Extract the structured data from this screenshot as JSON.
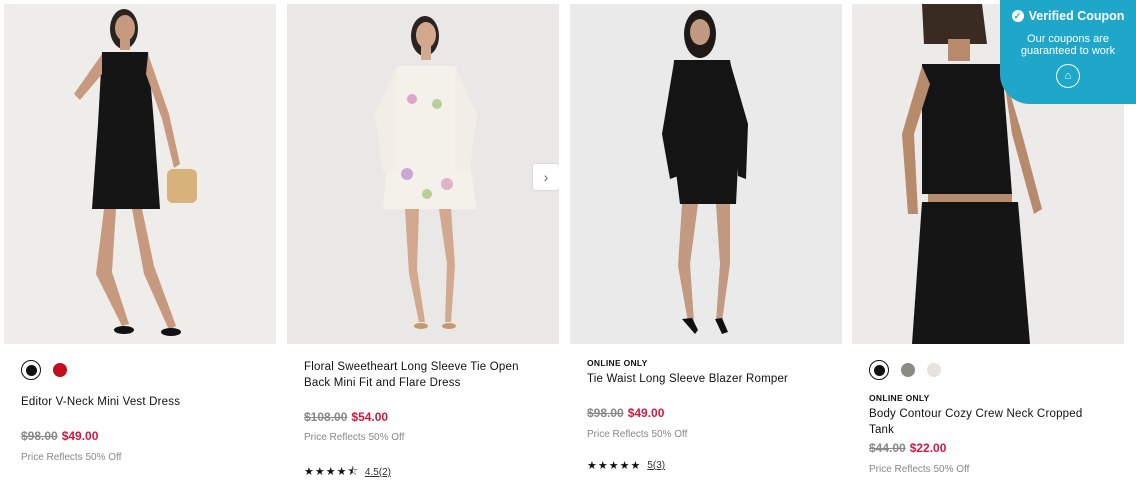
{
  "products": [
    {
      "name": "Editor V-Neck Mini Vest Dress",
      "tag": "",
      "swatches": [
        "#111111",
        "#c40e1e"
      ],
      "original_price": "$98.00",
      "sale_price": "$49.00",
      "note": "Price Reflects 50% Off",
      "rating": "",
      "rating_count": ""
    },
    {
      "name": "Floral Sweetheart Long Sleeve Tie Open Back Mini Fit and Flare Dress",
      "tag": "",
      "swatches": [],
      "original_price": "$108.00",
      "sale_price": "$54.00",
      "note": "Price Reflects 50% Off",
      "rating_stars": "★★★★⯪",
      "rating_count": "4.5(2)"
    },
    {
      "name": "Tie Waist Long Sleeve Blazer Romper",
      "tag": "ONLINE ONLY",
      "swatches": [],
      "original_price": "$98.00",
      "sale_price": "$49.00",
      "note": "Price Reflects 50% Off",
      "rating_stars": "★★★★★",
      "rating_count": "5(3)"
    },
    {
      "name": "Body Contour Cozy Crew Neck Cropped Tank",
      "tag": "ONLINE ONLY",
      "swatches": [
        "#111111",
        "#8a8a86",
        "#e8e3dd"
      ],
      "original_price": "$44.00",
      "sale_price": "$22.00",
      "note": "Price Reflects 50% Off",
      "rating": "",
      "rating_count": ""
    }
  ],
  "coupon": {
    "title": "Verified Coupon",
    "subtitle": "Our coupons are guaranteed to work",
    "color": "#1fa7c9"
  },
  "colors": {
    "sale": "#d1183f",
    "muted": "#888888"
  }
}
